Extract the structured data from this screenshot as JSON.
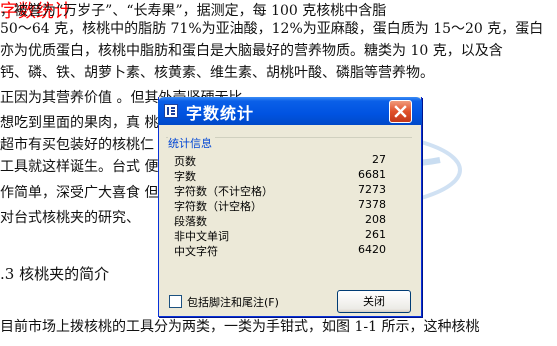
{
  "document": {
    "caption": "字数统计",
    "lines": [
      "                          ，被誉为“万岁子”、“长寿果”，据测定，每 100 克核桃中含脂",
      "50～64 克，核桃中的脂肪 71%为亚油酸，12%为亚麻酸，蛋白质为 15～20 克，蛋白",
      "亦为优质蛋白，核桃中脂肪和蛋白是大脑最好的营养物质。糖类为 10 克，以及含",
      "钙、磷、铁、胡萝卜素、核黄素、维生素、胡桃叶酸、磷脂等营养物。",
      "    正因为其营养价值                                       。但其外壳坚硬无比",
      "想吃到里面的果肉，真                                       桃但又不想费事的人",
      "超市有买包装好的核桃仁                                     米，所以用来拨核桃",
      "工具就这样诞生。台式                                       便快捷，价格实惠，",
      "作简单，深受广大喜食                                       但社会需求很大。所",
      "对台式核桃夹的研究、"
    ],
    "heading": ".3  核桃夹的简介",
    "footer_line": "    目前市场上拨核桃的工具分为两类，一类为手钳式，如图 1-1 所示，这种核桃"
  },
  "watermark": {
    "text": "www.docin.com"
  },
  "dialog": {
    "title": "字数统计",
    "group_label": "统计信息",
    "stats": [
      {
        "label": "页数",
        "value": "27"
      },
      {
        "label": "字数",
        "value": "6681"
      },
      {
        "label": "字符数（不计空格）",
        "value": "7273"
      },
      {
        "label": "字符数（计空格）",
        "value": "7378"
      },
      {
        "label": "段落数",
        "value": "208"
      },
      {
        "label": "非中文单词",
        "value": "261"
      },
      {
        "label": "中文字符",
        "value": "6420"
      }
    ],
    "checkbox_label": "包括脚注和尾注(F)",
    "close_label": "关闭"
  },
  "colors": {
    "titlebar": "#0053e1",
    "group_label": "#0046d5",
    "caption": "#ff0000",
    "close_x": "#e0512a"
  },
  "icons": {
    "title": "word-count-icon",
    "close": "close-icon"
  }
}
